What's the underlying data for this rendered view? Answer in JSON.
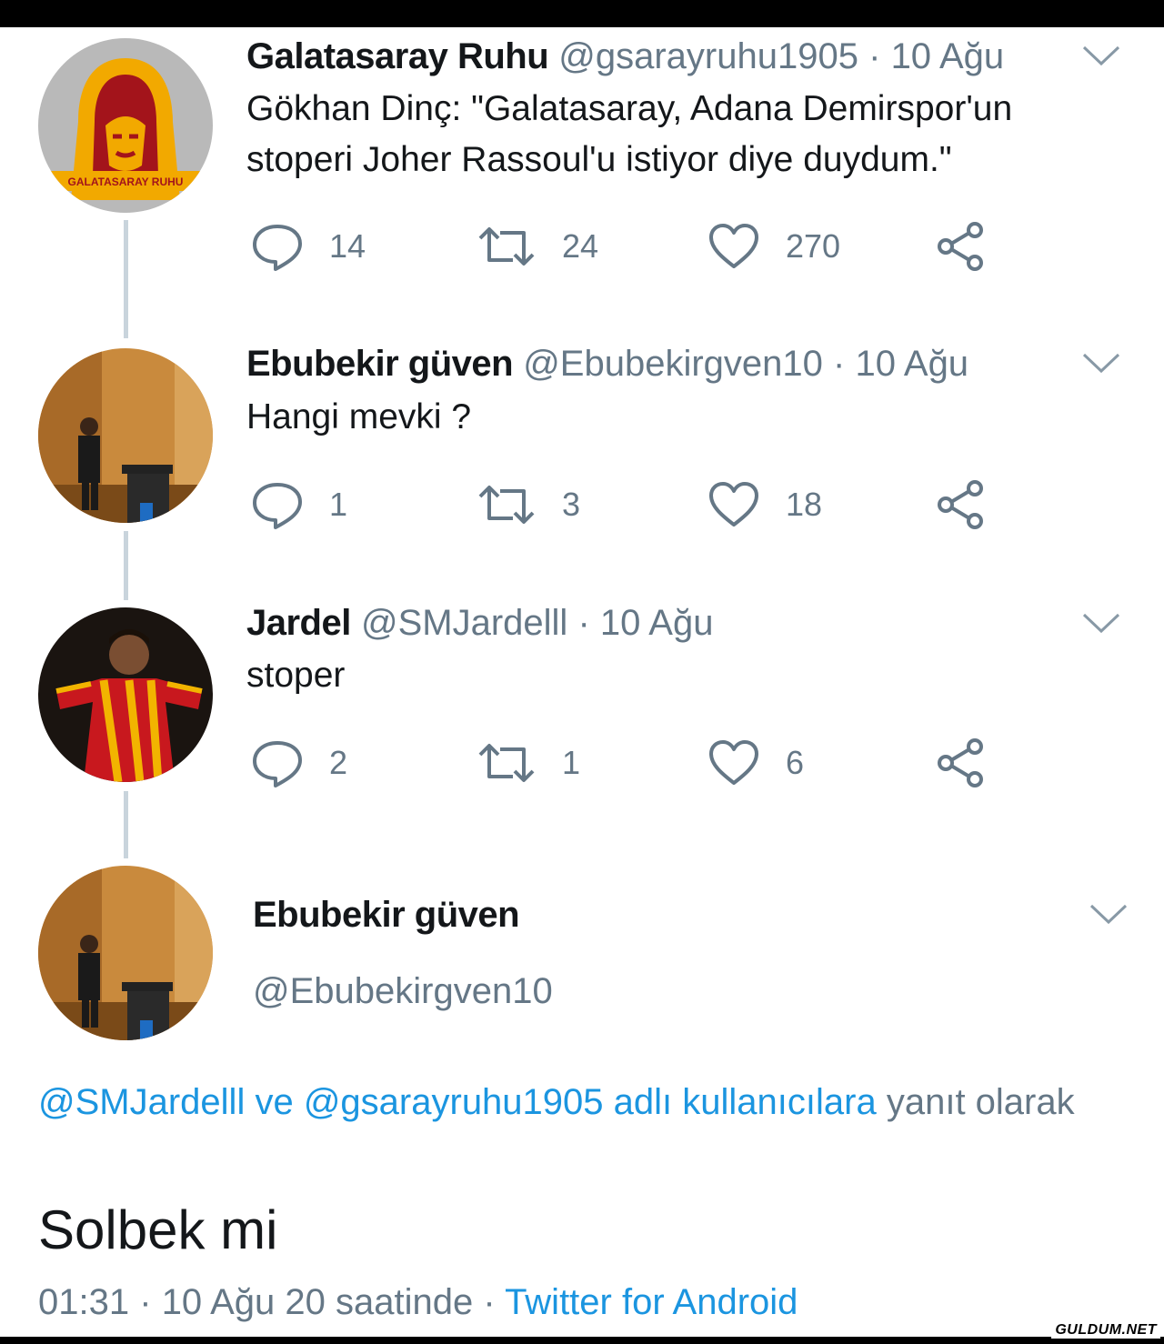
{
  "tweets": [
    {
      "name": "Galatasaray Ruhu",
      "handle": "@gsarayruhu1905",
      "dot": "·",
      "date": "10 Ağu",
      "text_lines": [
        "Gökhan Dinç: \"Galatasaray, Adana Demirspor'un",
        "stoperi Joher Rassoul'u istiyor diye duydum.\""
      ],
      "avatar_text": "GALATASARAY RUHU",
      "replies": "14",
      "retweets": "24",
      "likes": "270"
    },
    {
      "name": "Ebubekir güven",
      "handle": "@Ebubekirgven10",
      "dot": "·",
      "date": "10 Ağu",
      "text_lines": [
        "Hangi mevki ?"
      ],
      "replies": "1",
      "retweets": "3",
      "likes": "18"
    },
    {
      "name": "Jardel",
      "handle": "@SMJardelll",
      "dot": "·",
      "date": "10 Ağu",
      "text_lines": [
        "stoper"
      ],
      "replies": "2",
      "retweets": "1",
      "likes": "6"
    }
  ],
  "main_tweet": {
    "name": "Ebubekir güven",
    "handle": "@Ebubekirgven10",
    "reply_to": {
      "mention1": "@SMJardelll",
      "ve": "ve",
      "mention2": "@gsarayruhu1905",
      "adli": "adlı kullanıcılara",
      "suffix": "yanıt olarak"
    },
    "text": "Solbek mi",
    "time": "01:31",
    "dot": "·",
    "date_views": "10 Ağu 20 saatinde",
    "dot2": "·",
    "source": "Twitter for Android"
  },
  "icons": [
    "reply-icon",
    "retweet-icon",
    "like-icon",
    "share-icon",
    "chevron-down-icon"
  ],
  "colors": {
    "link": "#1b95e0",
    "secondary": "#657786",
    "text": "#14171a",
    "thread_line": "#c9d4dc"
  },
  "watermark": "GULDUM.NET"
}
